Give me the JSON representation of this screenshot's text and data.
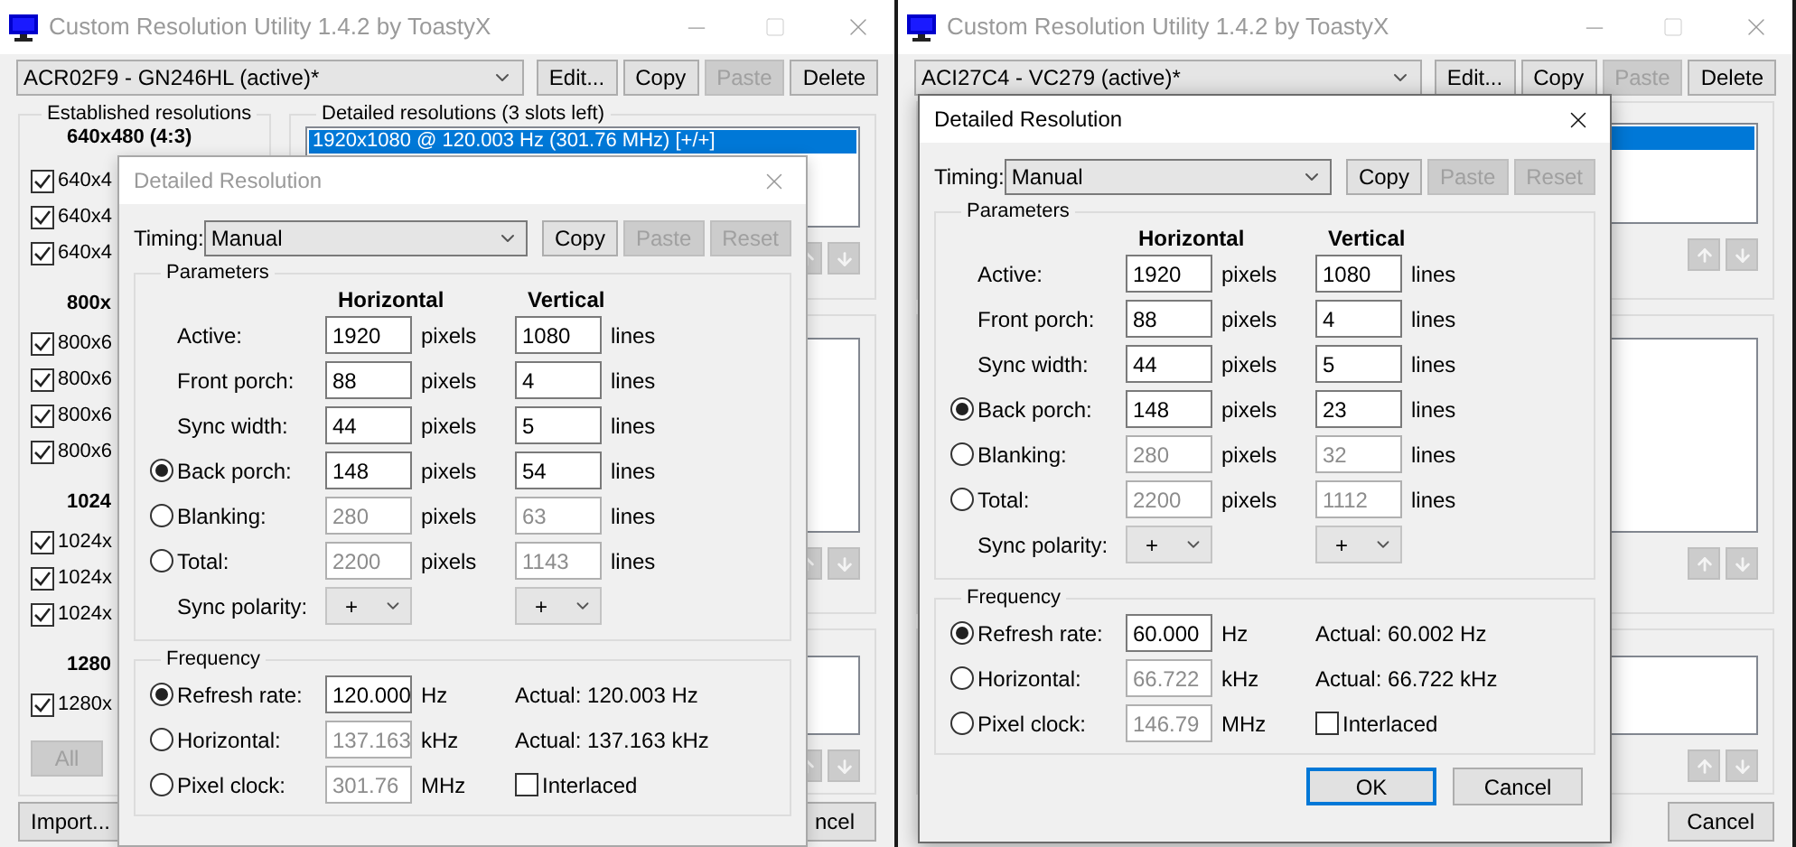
{
  "windows": [
    {
      "title": "Custom Resolution Utility 1.4.2 by ToastyX",
      "monitor": "ACR02F9 - GN246HL (active)*",
      "buttons": [
        {
          "label": "Edit...",
          "disabled": false
        },
        {
          "label": "Copy",
          "disabled": false
        },
        {
          "label": "Paste",
          "disabled": true
        },
        {
          "label": "Delete",
          "disabled": false
        }
      ],
      "established": {
        "title": "Established resolutions",
        "groups": [
          {
            "heading": "640x480 (4:3)",
            "items": [
              {
                "label": "640x4",
                "checked": true
              },
              {
                "label": "640x4",
                "checked": true
              },
              {
                "label": "640x4",
                "checked": true
              }
            ]
          },
          {
            "heading": "800x",
            "items": [
              {
                "label": "800x6",
                "checked": true
              },
              {
                "label": "800x6",
                "checked": true
              },
              {
                "label": "800x6",
                "checked": true
              },
              {
                "label": "800x6",
                "checked": true
              }
            ]
          },
          {
            "heading": "1024",
            "items": [
              {
                "label": "1024x",
                "checked": true
              },
              {
                "label": "1024x",
                "checked": true
              },
              {
                "label": "1024x",
                "checked": true
              }
            ]
          },
          {
            "heading": "1280",
            "items": [
              {
                "label": "1280x",
                "checked": true
              }
            ]
          }
        ],
        "buttons": [
          {
            "label": "All",
            "disabled": true
          }
        ]
      },
      "detailed": {
        "title": "Detailed resolutions (3 slots left)",
        "rows": [
          {
            "label": "1920x1080 @ 120.003 Hz (301.76 MHz) [+/+]",
            "selected": true
          }
        ]
      },
      "left_buttons": [
        "Import..."
      ],
      "right_buttons": [
        "ncel"
      ],
      "dialog": {
        "title": "Detailed Resolution",
        "active": false,
        "timing_label": "Timing:",
        "timing": "Manual",
        "buttons": [
          {
            "label": "Copy",
            "disabled": false
          },
          {
            "label": "Paste",
            "disabled": true
          },
          {
            "label": "Reset",
            "disabled": true
          }
        ],
        "parameters": {
          "title": "Parameters",
          "columns": [
            "Horizontal",
            "Vertical"
          ],
          "rows": [
            {
              "kind": "plain",
              "label": "Active:",
              "h": "1920",
              "h_unit": "pixels",
              "v": "1080",
              "v_unit": "lines",
              "disabled": false
            },
            {
              "kind": "plain",
              "label": "Front porch:",
              "h": "88",
              "h_unit": "pixels",
              "v": "4",
              "v_unit": "lines",
              "disabled": false
            },
            {
              "kind": "plain",
              "label": "Sync width:",
              "h": "44",
              "h_unit": "pixels",
              "v": "5",
              "v_unit": "lines",
              "disabled": false
            },
            {
              "kind": "radio",
              "selected": true,
              "label": "Back porch:",
              "h": "148",
              "h_unit": "pixels",
              "v": "54",
              "v_unit": "lines",
              "disabled": false
            },
            {
              "kind": "radio",
              "selected": false,
              "label": "Blanking:",
              "h": "280",
              "h_unit": "pixels",
              "v": "63",
              "v_unit": "lines",
              "disabled": true
            },
            {
              "kind": "radio",
              "selected": false,
              "label": "Total:",
              "h": "2200",
              "h_unit": "pixels",
              "v": "1143",
              "v_unit": "lines",
              "disabled": true
            }
          ],
          "polarity": {
            "label": "Sync polarity:",
            "h": "+",
            "v": "+"
          }
        },
        "frequency": {
          "title": "Frequency",
          "rows": [
            {
              "label": "Refresh rate:",
              "selected": true,
              "value": "120.000",
              "unit": "Hz",
              "disabled": false,
              "actual": "Actual: 120.003 Hz"
            },
            {
              "label": "Horizontal:",
              "selected": false,
              "value": "137.163",
              "unit": "kHz",
              "disabled": true,
              "actual": "Actual: 137.163 kHz"
            },
            {
              "label": "Pixel clock:",
              "selected": false,
              "value": "301.76",
              "unit": "MHz",
              "disabled": true
            }
          ],
          "interlaced": {
            "label": "Interlaced",
            "checked": false
          }
        }
      }
    },
    {
      "title": "Custom Resolution Utility 1.4.2 by ToastyX",
      "monitor": "ACI27C4 - VC279 (active)*",
      "buttons": [
        {
          "label": "Edit...",
          "disabled": false
        },
        {
          "label": "Copy",
          "disabled": false
        },
        {
          "label": "Paste",
          "disabled": true
        },
        {
          "label": "Delete",
          "disabled": false
        }
      ],
      "detailed": {
        "rows": [
          {
            "selected": true
          }
        ]
      },
      "right_buttons": [
        "Cancel"
      ],
      "dialog": {
        "title": "Detailed Resolution",
        "active": true,
        "timing_label": "Timing:",
        "timing": "Manual",
        "buttons": [
          {
            "label": "Copy",
            "disabled": false
          },
          {
            "label": "Paste",
            "disabled": true
          },
          {
            "label": "Reset",
            "disabled": true
          }
        ],
        "parameters": {
          "title": "Parameters",
          "columns": [
            "Horizontal",
            "Vertical"
          ],
          "rows": [
            {
              "kind": "plain",
              "label": "Active:",
              "h": "1920",
              "h_unit": "pixels",
              "v": "1080",
              "v_unit": "lines",
              "disabled": false
            },
            {
              "kind": "plain",
              "label": "Front porch:",
              "h": "88",
              "h_unit": "pixels",
              "v": "4",
              "v_unit": "lines",
              "disabled": false
            },
            {
              "kind": "plain",
              "label": "Sync width:",
              "h": "44",
              "h_unit": "pixels",
              "v": "5",
              "v_unit": "lines",
              "disabled": false
            },
            {
              "kind": "radio",
              "selected": true,
              "label": "Back porch:",
              "h": "148",
              "h_unit": "pixels",
              "v": "23",
              "v_unit": "lines",
              "disabled": false
            },
            {
              "kind": "radio",
              "selected": false,
              "label": "Blanking:",
              "h": "280",
              "h_unit": "pixels",
              "v": "32",
              "v_unit": "lines",
              "disabled": true
            },
            {
              "kind": "radio",
              "selected": false,
              "label": "Total:",
              "h": "2200",
              "h_unit": "pixels",
              "v": "1112",
              "v_unit": "lines",
              "disabled": true
            }
          ],
          "polarity": {
            "label": "Sync polarity:",
            "h": "+",
            "v": "+"
          }
        },
        "frequency": {
          "title": "Frequency",
          "rows": [
            {
              "label": "Refresh rate:",
              "selected": true,
              "value": "60.000",
              "unit": "Hz",
              "disabled": false,
              "actual": "Actual: 60.002 Hz"
            },
            {
              "label": "Horizontal:",
              "selected": false,
              "value": "66.722",
              "unit": "kHz",
              "disabled": true,
              "actual": "Actual: 66.722 kHz"
            },
            {
              "label": "Pixel clock:",
              "selected": false,
              "value": "146.79",
              "unit": "MHz",
              "disabled": true
            }
          ],
          "interlaced": {
            "label": "Interlaced",
            "checked": false
          }
        },
        "actions": [
          {
            "label": "OK",
            "default": true
          },
          {
            "label": "Cancel",
            "default": false
          }
        ]
      }
    }
  ]
}
